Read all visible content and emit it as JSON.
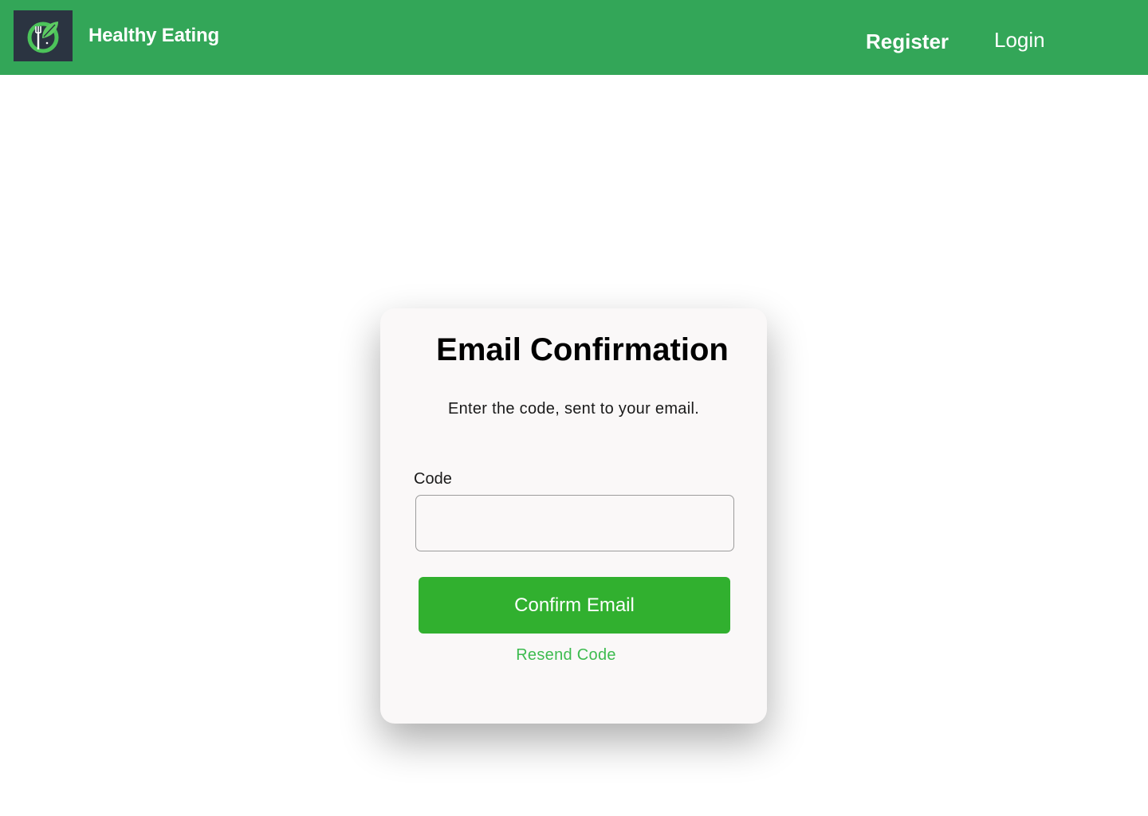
{
  "header": {
    "brand": "Healthy Eating",
    "logo_icon": "fork-leaf-logo-icon",
    "nav": {
      "register": "Register",
      "login": "Login"
    },
    "background_color": "#33a658"
  },
  "confirmation": {
    "title": "Email Confirmation",
    "subtitle": "Enter the code, sent to your email.",
    "code_label": "Code",
    "code_value": "",
    "confirm_button": "Confirm Email",
    "resend_link": "Resend Code",
    "button_color": "#31b02f",
    "link_color": "#3dbb4f"
  }
}
